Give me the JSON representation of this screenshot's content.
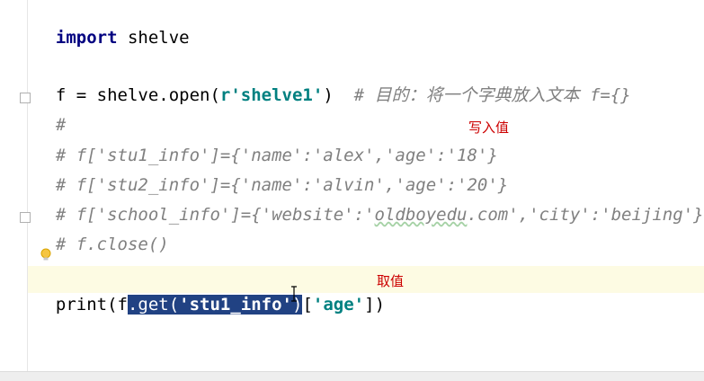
{
  "editor": {
    "lines": [
      {
        "kw": "import",
        "rest": " shelve"
      },
      {
        "pre": "f = shelve.open(",
        "str": "r'shelve1'",
        "post": ")  ",
        "comment": "# 目的：将一个字典放入文本 f={}"
      },
      {
        "comment": "#"
      },
      {
        "comment": "# f['stu1_info']={'name':'alex','age':'18'}"
      },
      {
        "comment": "# f['stu2_info']={'name':'alvin','age':'20'}"
      },
      {
        "comment_pre": "# f['school_info']={'website':'",
        "comment_sq": "oldboyedu",
        "comment_post": ".com','city':'beijing'}"
      },
      {
        "comment": "# f.close()"
      },
      {
        "pre": "print(f",
        "sel_pre": ".get(",
        "sel_str": "'stu1_info'",
        "sel_post": ")",
        "post": "[",
        "str": "'age'",
        "post2": "])"
      }
    ],
    "annotations": {
      "write": "写入值",
      "read": "取值"
    }
  },
  "icons": [
    "lightbulb-icon",
    "fold-marker-icon",
    "text-cursor-icon"
  ]
}
